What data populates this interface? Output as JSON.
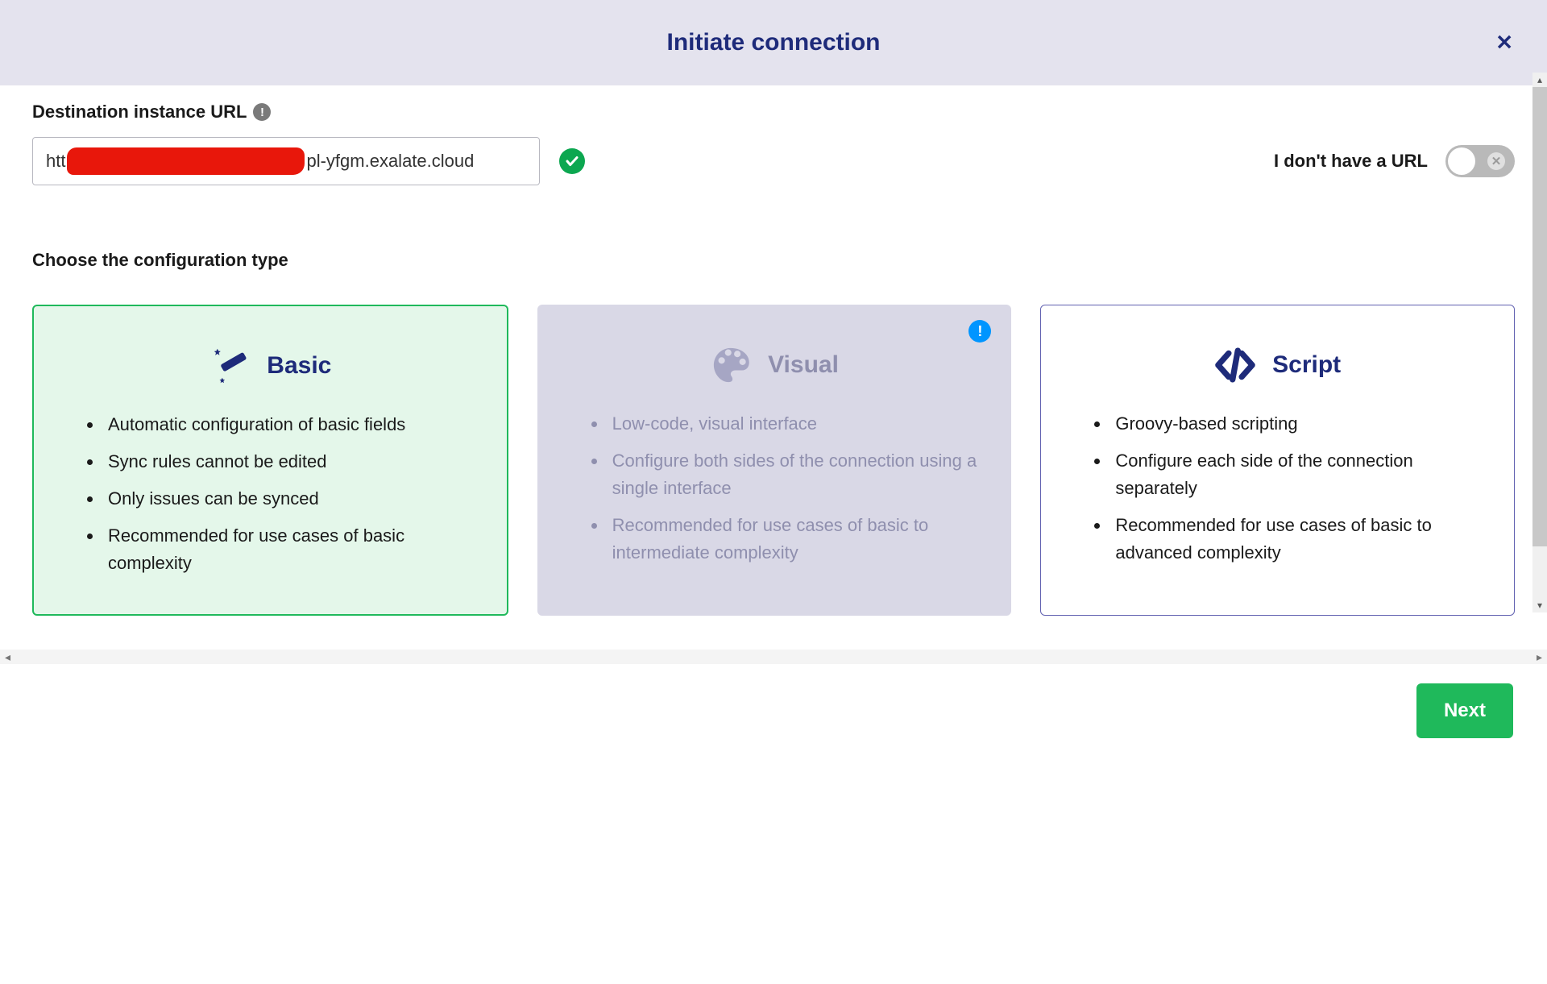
{
  "dialog": {
    "title": "Initiate connection"
  },
  "url_section": {
    "label": "Destination instance URL",
    "value_prefix": "htt",
    "value_suffix": "pl-yfgm.exalate.cloud",
    "no_url_label": "I don't have a URL",
    "no_url_toggle_on": false
  },
  "config_section": {
    "label": "Choose the configuration type"
  },
  "cards": {
    "basic": {
      "title": "Basic",
      "items": [
        "Automatic configuration of basic fields",
        "Sync rules cannot be edited",
        "Only issues can be synced",
        "Recommended for use cases of basic complexity"
      ],
      "selected": true
    },
    "visual": {
      "title": "Visual",
      "items": [
        "Low-code, visual interface",
        "Configure both sides of the connection using a single interface",
        "Recommended for use cases of basic to intermediate complexity"
      ],
      "disabled": true
    },
    "script": {
      "title": "Script",
      "items": [
        "Groovy-based scripting",
        "Configure each side of the connection separately",
        "Recommended for use cases of basic to advanced complexity"
      ]
    }
  },
  "footer": {
    "next_label": "Next"
  },
  "colors": {
    "brand_navy": "#1e2b7a",
    "green": "#1fb95b",
    "header_bg": "#e4e3ee"
  }
}
